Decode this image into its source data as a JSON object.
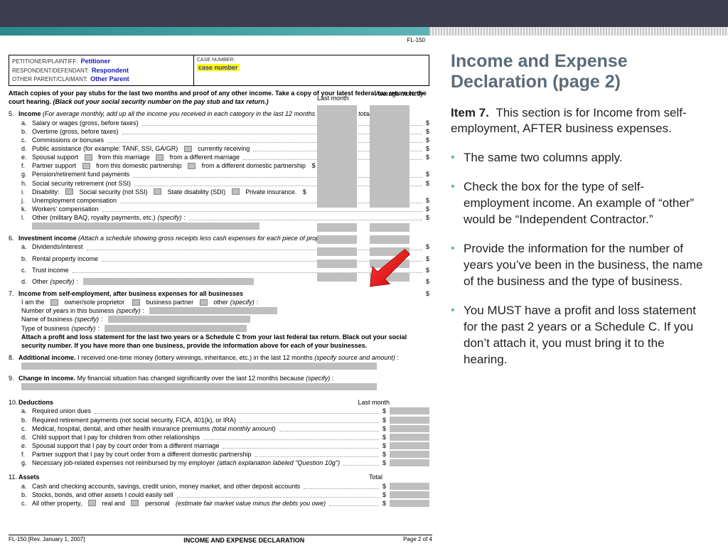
{
  "header": {
    "petLabel": "PETITIONER/PLAINTIFF:",
    "petVal": "Petitioner",
    "respLabel": "RESPONDENT/DEFENDANT:",
    "respVal": "Respondent",
    "otherLabel": "OTHER PARENT/CLAIMANT:",
    "otherVal": "Other Parent",
    "caseNumLabel": "CASE NUMBER:",
    "caseNumVal": "case number",
    "formCode": "FL-150"
  },
  "instructions": "Attach copies of your pay stubs for the last two months and proof of any other income. Take a copy of your latest federal tax return to the court hearing.",
  "instructionsItalic": "(Black out your social security number on the pay stub and tax return.)",
  "col1": "Last month",
  "col2": "Average monthly",
  "s5": {
    "num": "5.",
    "title": "Income",
    "note": "(For average monthly, add up all the income you received in each category in the last 12 months and divide the total by 12.)",
    "a": "Salary or wages (gross, before taxes)",
    "b": "Overtime (gross, before taxes)",
    "c": "Commissions or bonuses",
    "d": "Public assistance (for example: TANF, SSI, GA/GR)",
    "d1": "currently receiving",
    "e": "Spousal support",
    "e1": "from this marriage",
    "e2": "from a different marriage",
    "f": "Partner support",
    "f1": "from this domestic partnership",
    "f2": "from a different domestic partnership",
    "g": "Pension/retirement fund payments",
    "h": "Social security retirement (not SSI)",
    "i": "Disability:",
    "i1": "Social security (not SSI)",
    "i2": "State disability (SDI)",
    "i3": "Private insurance.",
    "j": "Unemployment compensation",
    "k": "Workers' compensation",
    "l": "Other (military BAQ, royalty payments, etc.)",
    "lsp": "(specify)"
  },
  "s6": {
    "num": "6.",
    "title": "Investment income",
    "note": "(Attach a schedule showing gross receipts less cash expenses for each piece of property.)",
    "a": "Dividends/interest",
    "b": "Rental property income",
    "c": "Trust income",
    "d": "Other",
    "dsp": "(specify)"
  },
  "s7": {
    "num": "7.",
    "title": "Income from self-employment, after business expenses for all businesses",
    "iam": "I am the",
    "o1": "owner/sole proprietor",
    "o2": "business partner",
    "o3": "other",
    "osp": "(specify)",
    "yrs": "Number of years in this business",
    "name": "Name of business",
    "type": "Type of business",
    "att": "Attach a profit and loss statement for the last two years or a Schedule C from your last federal tax return. Black out your social security number. If you have more than one business, provide the information above for each of your businesses."
  },
  "s8": {
    "num": "8.",
    "title": "Additional income.",
    "txt": "I received one-time money (lottery winnings, inheritance, etc.) in the last 12 months",
    "sp": "(specify source and amount)"
  },
  "s9": {
    "num": "9.",
    "title": "Change in income.",
    "txt": "My financial situation has changed significantly over the last 12 months because",
    "sp": "(specify)"
  },
  "s10": {
    "num": "10.",
    "title": "Deductions",
    "col": "Last month",
    "a": "Required union dues",
    "b": "Required retirement payments (not social security, FICA, 401(k), or IRA)",
    "c": "Medical, hospital, dental, and other health insurance premiums",
    "csp": "(total monthly amount)",
    "d": "Child support that I pay for children from other relationships",
    "e": "Spousal support that I pay by court order from a different marriage",
    "f": "Partner support that I pay by court order from a different domestic partnership",
    "g": "Necessary job-related expenses not reimbursed by my employer",
    "gsp": "(attach explanation labeled \"Question 10g\")"
  },
  "s11": {
    "num": "11.",
    "title": "Assets",
    "col": "Total",
    "a": "Cash and checking accounts, savings, credit union, money market, and other deposit accounts",
    "b": "Stocks, bonds, and other assets I could easily sell",
    "c": "All other property,",
    "c1": "real and",
    "c2": "personal",
    "csp": "(estimate fair market value minus the debts you owe)"
  },
  "footer": {
    "left": "FL-150 [Rev. January 1, 2007]",
    "mid": "INCOME AND EXPENSE DECLARATION",
    "right": "Page 2 of 4"
  },
  "side": {
    "title": "Income and Expense Declaration (page 2)",
    "lead": "Item 7.",
    "leadTxt": "This section is for Income from self-employment, AFTER business expenses.",
    "b1": "The same two columns apply.",
    "b2": "Check the box for the type of self-employment income.  An example of “other” would be “Independent Contractor.”",
    "b3": "Provide the information for the number of years you’ve been in the business, the name of the business and the type of business.",
    "b4": "You MUST have a profit and loss statement for the past 2 years or a Schedule C.  If you don’t attach it, you must bring it to the hearing."
  }
}
